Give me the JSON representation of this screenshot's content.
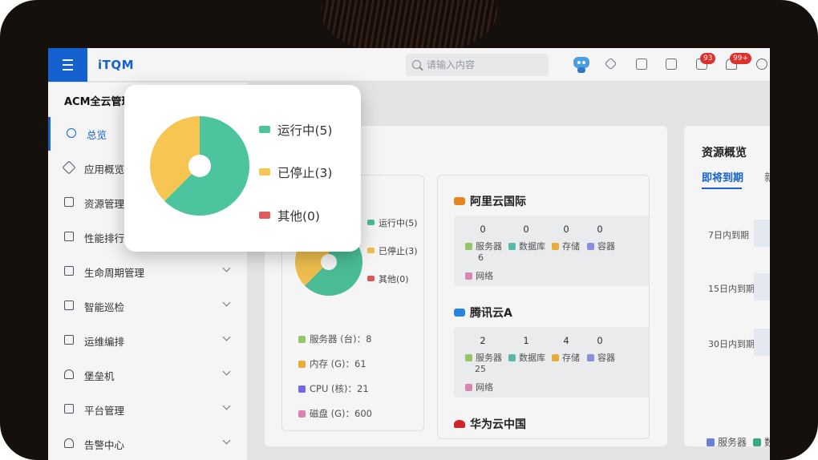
{
  "app": {
    "logo": "iTQM"
  },
  "topbar": {
    "search_placeholder": "请输入内容",
    "badges": {
      "tasks": "93",
      "notifications": "99+"
    }
  },
  "sidebar": {
    "title": "ACM全云管理",
    "items": [
      {
        "label": "总览",
        "active": true,
        "expandable": false
      },
      {
        "label": "应用概览",
        "expandable": false
      },
      {
        "label": "资源管理",
        "expandable": false
      },
      {
        "label": "性能排行",
        "expandable": false
      },
      {
        "label": "生命周期管理",
        "expandable": true
      },
      {
        "label": "智能巡检",
        "expandable": true
      },
      {
        "label": "运维编排",
        "expandable": true
      },
      {
        "label": "堡垒机",
        "expandable": true
      },
      {
        "label": "平台管理",
        "expandable": true
      },
      {
        "label": "告警中心",
        "expandable": true
      }
    ]
  },
  "status_summary": {
    "legend": [
      "运行中(5)",
      "已停止(3)",
      "其他(0)"
    ],
    "stats": [
      {
        "label": "服务器 (台)：8"
      },
      {
        "label": "内存 (G)：61"
      },
      {
        "label": "CPU (核)：21"
      },
      {
        "label": "磁盘 (G)：600"
      }
    ]
  },
  "clouds": [
    {
      "name": "阿里云国际",
      "values": [
        "0",
        "0",
        "0",
        "0"
      ],
      "labels": [
        "服务器",
        "数据库",
        "存储",
        "容器"
      ],
      "extra_value": "6",
      "extra_label": "网络"
    },
    {
      "name": "腾讯云A",
      "values": [
        "2",
        "1",
        "4",
        "0"
      ],
      "labels": [
        "服务器",
        "数据库",
        "存储",
        "容器"
      ],
      "extra_value": "25",
      "extra_label": "网络"
    },
    {
      "name": "华为云中国"
    }
  ],
  "resource_overview": {
    "title": "资源概览",
    "tabs": [
      "即将到期",
      "新"
    ],
    "rows": [
      "7日内到期",
      "15日内到期",
      "30日内到期"
    ],
    "legend": [
      "服务器",
      "数"
    ]
  },
  "popup": {
    "legend": [
      "运行中(5)",
      "已停止(3)",
      "其他(0)"
    ]
  },
  "chart_data": {
    "type": "pie",
    "categories": [
      "运行中(5)",
      "已停止(3)",
      "其他(0)"
    ],
    "values": [
      5,
      3,
      0
    ],
    "colors": [
      "#4cc49d",
      "#f7c552",
      "#e15b5b"
    ]
  },
  "colors": {
    "accent": "#1565d8",
    "running": "#4cc49d",
    "stopped": "#f7c552",
    "other": "#e15b5b"
  }
}
